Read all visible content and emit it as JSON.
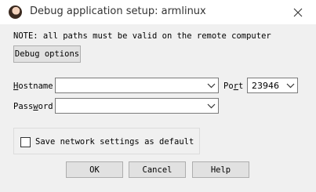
{
  "window": {
    "title": "Debug application setup: armlinux"
  },
  "note": "NOTE: all paths must be valid on the remote computer",
  "debug_options_label": "Debug options",
  "fields": {
    "hostname": {
      "label_first": "H",
      "label_rest": "ostname",
      "value": ""
    },
    "port": {
      "label_pre": "Po",
      "label_u": "r",
      "label_post": "t",
      "value": "23946"
    },
    "password": {
      "label_pre": "Pass",
      "label_u": "w",
      "label_post": "ord",
      "value": ""
    }
  },
  "save_network": {
    "label": "Save network settings as default",
    "checked": false
  },
  "buttons": {
    "ok": "OK",
    "cancel": "Cancel",
    "help": "Help"
  },
  "icons": {
    "app": "user-avatar-icon",
    "close": "close-icon",
    "dropdown": "chevron-down-icon"
  }
}
